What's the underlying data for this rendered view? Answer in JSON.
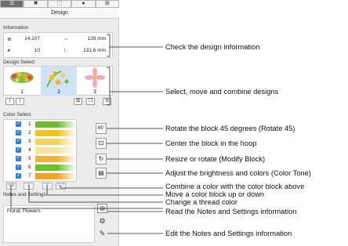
{
  "tabs": [
    {
      "icon": "☰",
      "name": "list-view"
    },
    {
      "icon": "✖",
      "name": "stitch-view"
    },
    {
      "icon": "⬚",
      "name": "frame-view"
    },
    {
      "icon": "●",
      "name": "color-view"
    },
    {
      "icon": "⊞",
      "name": "grid-view"
    }
  ],
  "panel_title": "Design",
  "information": {
    "heading": "Information",
    "stitches": "14,107",
    "width": "139 mm",
    "colors": "10",
    "height": "131.6 mm"
  },
  "design_select": {
    "heading": "Design Select",
    "items": [
      {
        "number": "1"
      },
      {
        "number": "2"
      },
      {
        "number": "3"
      }
    ]
  },
  "color_select": {
    "heading": "Color Select",
    "rows": [
      {
        "number": "1",
        "color": "#6dbf2a"
      },
      {
        "number": "2",
        "color": "#f2c21b"
      },
      {
        "number": "3",
        "color": "#f7d25a"
      },
      {
        "number": "4",
        "color": "#fbe0a0"
      },
      {
        "number": "5",
        "color": "#f5b23a"
      },
      {
        "number": "6",
        "color": "#6dbf2a"
      },
      {
        "number": "7",
        "color": "#f5a21c"
      }
    ]
  },
  "side_buttons": {
    "rotate45": "45°",
    "center": "⊡",
    "modify": "↻",
    "tone": "▤"
  },
  "notes": {
    "heading": "Notes and Settings",
    "text": "Floral; Flowers"
  },
  "callouts": {
    "check_info": "Check the design information",
    "select_designs": "Select, move and combine designs",
    "rotate": "Rotate the block 45 degrees (Rotate 45)",
    "center": "Center the block in the hoop",
    "resize": "Resize or rotate (Modify Block)",
    "tone": "Adjust the brightness and colors (Color Tone)",
    "combine": "Combine a color with the color block above",
    "move_block": "Move a color block up or down",
    "change_thread": "Change a thread color",
    "read_notes": "Read the Notes and Settings information",
    "edit_notes": "Edit the Notes and Settings information"
  }
}
